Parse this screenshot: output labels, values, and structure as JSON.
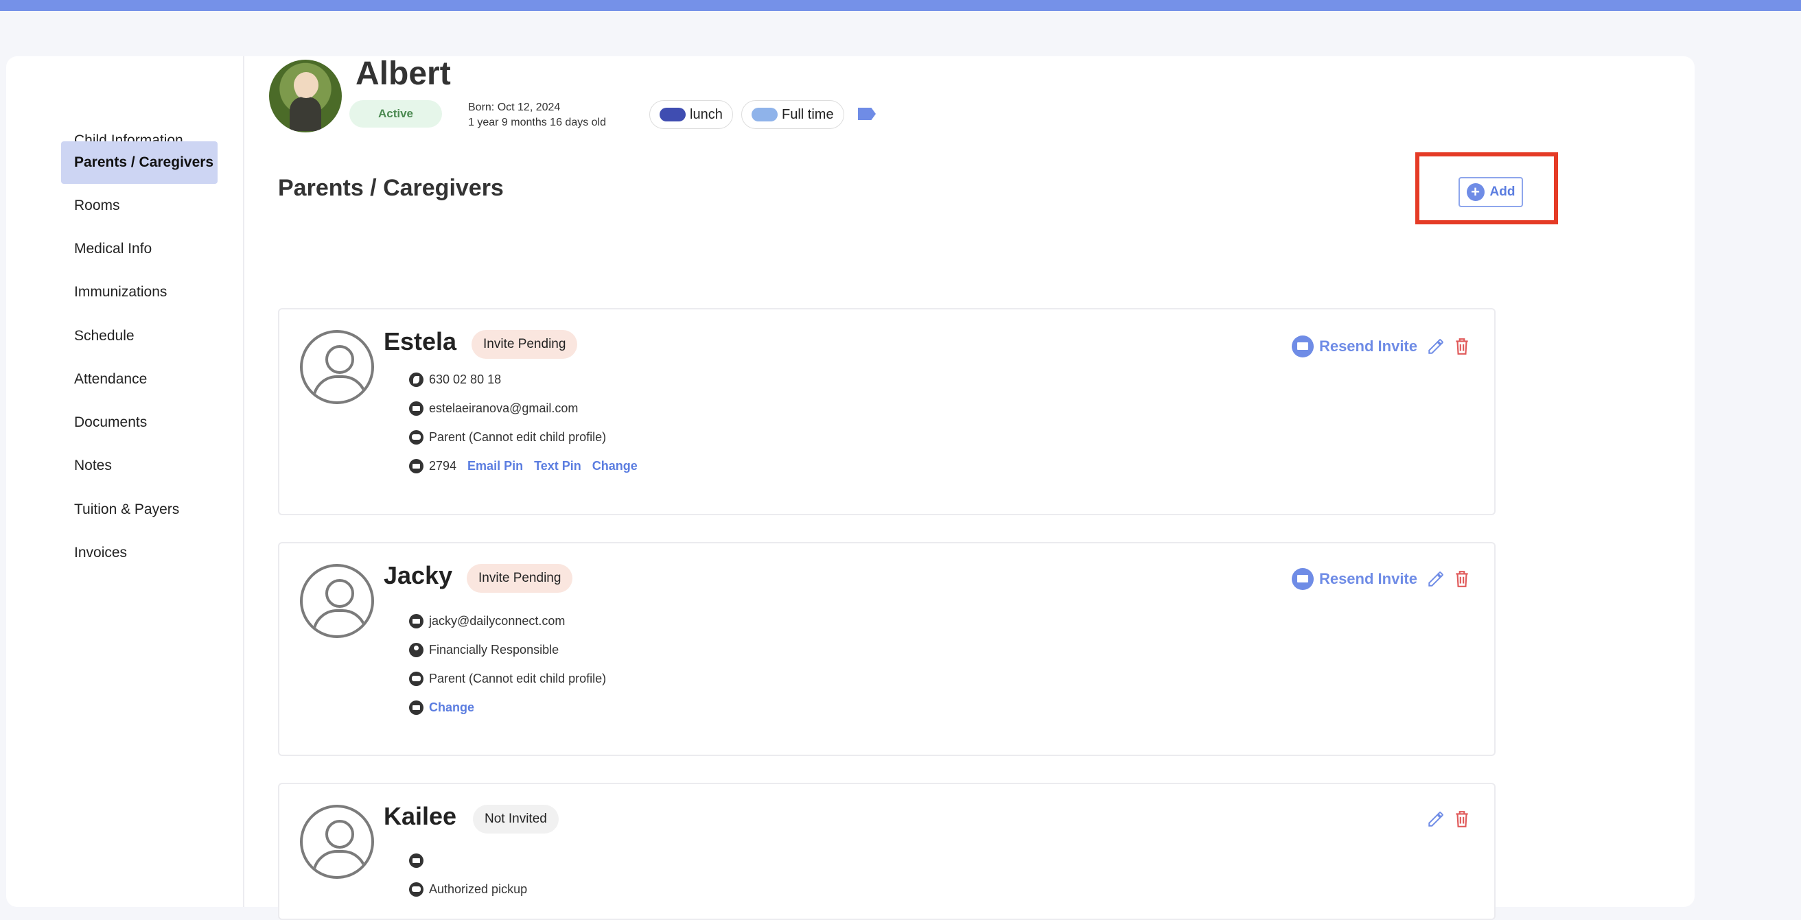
{
  "sidebar": {
    "items": [
      {
        "label": "Child Information",
        "active": false
      },
      {
        "label": "Parents / Caregivers",
        "active": true
      },
      {
        "label": "Rooms",
        "active": false
      },
      {
        "label": "Medical Info",
        "active": false
      },
      {
        "label": "Immunizations",
        "active": false
      },
      {
        "label": "Schedule",
        "active": false
      },
      {
        "label": "Attendance",
        "active": false
      },
      {
        "label": "Documents",
        "active": false
      },
      {
        "label": "Notes",
        "active": false
      },
      {
        "label": "Tuition & Payers",
        "active": false
      },
      {
        "label": "Invoices",
        "active": false
      }
    ]
  },
  "child": {
    "name": "Albert",
    "status": "Active",
    "born": "Born: Oct 12, 2024",
    "age": "1 year 9 months 16 days old",
    "tags": [
      {
        "label": "lunch",
        "color": "#3f4db1"
      },
      {
        "label": "Full time",
        "color": "#8fb3ea"
      }
    ]
  },
  "section": {
    "title": "Parents / Caregivers",
    "add_label": "Add"
  },
  "caregivers": [
    {
      "name": "Estela",
      "badge": "Invite Pending",
      "phone": "630 02 80 18",
      "email": "estelaeiranova@gmail.com",
      "role": "Parent (Cannot edit child profile)",
      "pin": "2794",
      "email_pin": "Email Pin",
      "text_pin": "Text Pin",
      "change": "Change",
      "resend": "Resend Invite"
    },
    {
      "name": "Jacky",
      "badge": "Invite Pending",
      "email": "jacky@dailyconnect.com",
      "financial": "Financially Responsible",
      "role": "Parent (Cannot edit child profile)",
      "change": "Change",
      "resend": "Resend Invite"
    },
    {
      "name": "Kailee",
      "badge": "Not Invited",
      "email": "",
      "role": "Authorized pickup"
    }
  ],
  "colors": {
    "accent": "#6f8ce6",
    "delete": "#e05a5a",
    "highlight": "#e53b26",
    "topbar": "#7591e8"
  }
}
